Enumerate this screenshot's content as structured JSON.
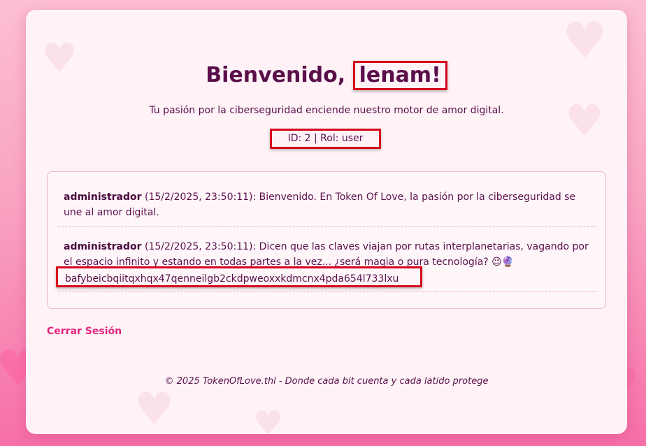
{
  "header": {
    "greeting": "Bienvenido,",
    "username": "lenam!",
    "subtitle": "Tu pasión por la ciberseguridad enciende nuestro motor de amor digital.",
    "id_role": "ID: 2 | Rol: user"
  },
  "messages": [
    {
      "author": "administrador",
      "timestamp": "(15/2/2025, 23:50:11):",
      "text": "Bienvenido. En Token Of Love, la pasión por la ciberseguridad se une al amor digital."
    },
    {
      "author": "administrador",
      "timestamp": "(15/2/2025, 23:50:11):",
      "text": "Dicen que las claves viajan por rutas interplanetarias, vagando por el espacio infinito y estando en todas partes a la vez... ¿será magia o pura tecnología? 😉🔮",
      "hash": "bafybeicbqiitqxhqx47qenneilgb2ckdpweoxxkdmcnx4pda654l733lxu"
    }
  ],
  "actions": {
    "logout": "Cerrar Sesión"
  },
  "footer": {
    "text": "© 2025 TokenOfLove.thl - Donde cada bit cuenta y cada latido protege"
  },
  "colors": {
    "accent": "#e0247c",
    "text": "#5a0f4a",
    "highlight_border": "#d6001c"
  }
}
